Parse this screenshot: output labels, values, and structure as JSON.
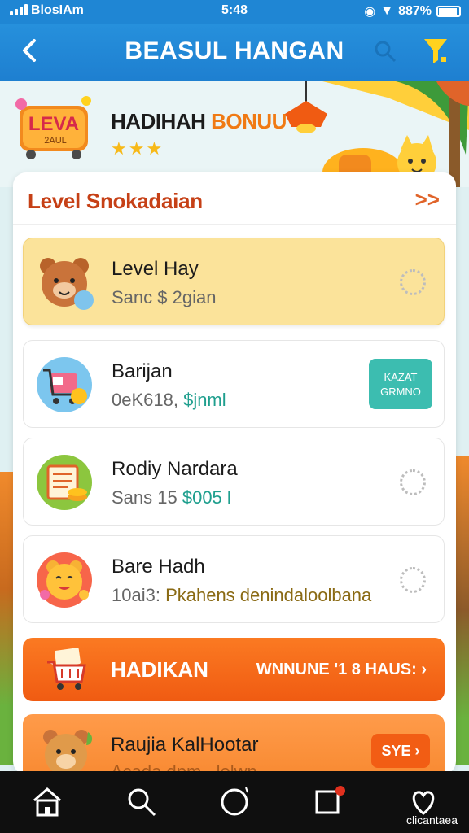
{
  "status_bar": {
    "carrier": "BlosIAm",
    "time": "5:48",
    "battery": "887%"
  },
  "header": {
    "title": "BEASUL HANGAN"
  },
  "banner": {
    "logo_text": "LEVA",
    "logo_sub": "2AUL",
    "title_part1": "HADIHAH ",
    "title_part2": "BONUU",
    "stars": "★★★"
  },
  "card": {
    "title": "Level Snokadaian",
    "more": ">>",
    "items": [
      {
        "name": "Level Hay",
        "sub_a": "Sanc $ 2gian",
        "sub_b": ""
      },
      {
        "name": "Barijan",
        "sub_a": "0eK618, ",
        "sub_b": "$jnml",
        "button": "KAZAT\nGRMNO"
      },
      {
        "name": "Rodiy Nardara",
        "sub_a": "Sans 15 ",
        "sub_b": "$005 l"
      },
      {
        "name": "Bare Hadh",
        "sub_a": "10ai3: ",
        "sub_b": "Pkahens denindaloolbana"
      }
    ],
    "action_bar": {
      "label": "HADIKAN",
      "cta": "WNNUNE '1 8 HAUS: ›"
    },
    "promo": {
      "name": "Raujia KalHootar",
      "sub": "Acada dpm...lolwn",
      "button": "SYE ›"
    }
  },
  "bottom_nav": {
    "caption": "clicantaea",
    "items": [
      "home-icon",
      "search-icon",
      "circle-icon",
      "square-icon",
      "heart-icon"
    ]
  },
  "colors": {
    "header_blue": "#1f86d4",
    "accent_orange": "#f05b12",
    "highlight_yellow": "#fbe39a",
    "teal": "#3cbdb0"
  }
}
